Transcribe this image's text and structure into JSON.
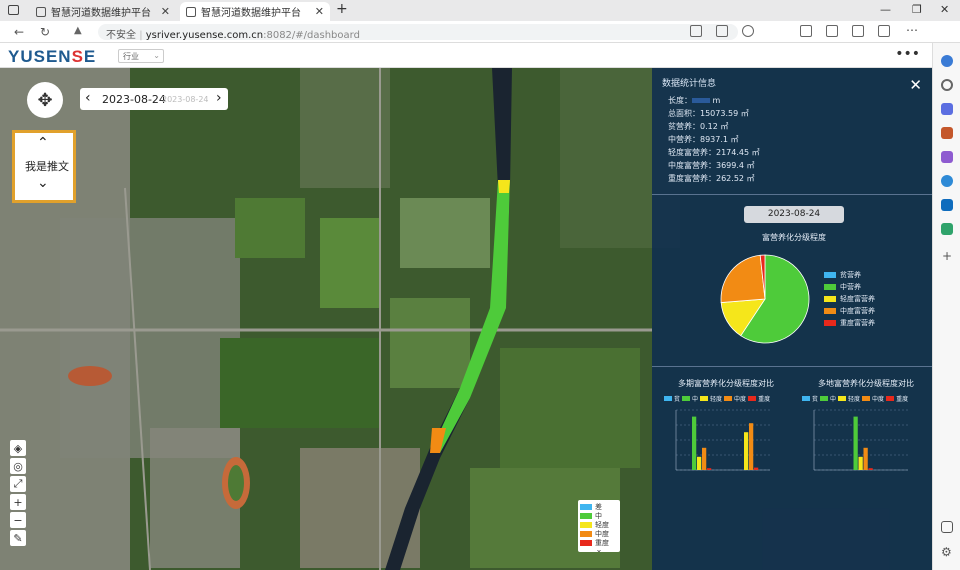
{
  "browser": {
    "tabs": [
      {
        "title": "智慧河道数据维护平台",
        "active": false
      },
      {
        "title": "智慧河道数据维护平台",
        "active": true
      }
    ],
    "new_tab": "+",
    "security": "不安全",
    "url_host": "ysriver.yusense.com.cn",
    "url_rest": ":8082/#/dashboard"
  },
  "app": {
    "logo_a": "YUSEN",
    "logo_b": "S",
    "logo_c": "E",
    "industry_select": "行业",
    "more_label": "•••"
  },
  "map": {
    "date_current": "2023-08-24",
    "date_compare": "2023-08-24",
    "scroll_label": "我是推文",
    "legend": [
      {
        "label": "差",
        "color": "#3fb5f0"
      },
      {
        "label": "中",
        "color": "#4ecb3a"
      },
      {
        "label": "轻度",
        "color": "#f5e61b"
      },
      {
        "label": "中度",
        "color": "#f28b14"
      },
      {
        "label": "重度",
        "color": "#e8291c"
      }
    ]
  },
  "panel": {
    "title": "数据统计信息",
    "stats": [
      {
        "label": "长度",
        "value": "m",
        "redacted": true
      },
      {
        "label": "总面积",
        "value": "15073.59 ㎡"
      },
      {
        "label": "贫营养",
        "value": "0.12 ㎡"
      },
      {
        "label": "中营养",
        "value": "8937.1 ㎡"
      },
      {
        "label": "轻度富营养",
        "value": "2174.45 ㎡"
      },
      {
        "label": "中度富营养",
        "value": "3699.4 ㎡"
      },
      {
        "label": "重度富营养",
        "value": "262.52 ㎡"
      }
    ],
    "pie_date": "2023-08-24",
    "pie_title": "富营养化分级程度",
    "bar1_title": "多期富营养化分级程度对比",
    "bar2_title": "多地富营养化分级程度对比",
    "bar_legend": [
      "贫",
      "中",
      "轻度",
      "中度",
      "重度"
    ]
  },
  "chart_data": [
    {
      "type": "pie",
      "title": "富营养化分级程度",
      "categories": [
        "贫营养",
        "中营养",
        "轻度富营养",
        "中度富营养",
        "重度富营养"
      ],
      "values": [
        0.12,
        8937.1,
        2174.45,
        3699.4,
        262.52
      ],
      "colors": [
        "#3fb5f0",
        "#4ecb3a",
        "#f5e61b",
        "#f28b14",
        "#e8291c"
      ],
      "legend": "right"
    },
    {
      "type": "bar",
      "title": "多期富营养化分级程度对比",
      "categories": [
        "",
        ""
      ],
      "series": [
        {
          "name": "贫",
          "values": [
            0,
            0
          ]
        },
        {
          "name": "中",
          "values": [
            8900,
            0
          ]
        },
        {
          "name": "轻度",
          "values": [
            2200,
            6300
          ]
        },
        {
          "name": "中度",
          "values": [
            3700,
            7800
          ]
        },
        {
          "name": "重度",
          "values": [
            300,
            400
          ]
        }
      ],
      "colors": [
        "#3fb5f0",
        "#4ecb3a",
        "#f5e61b",
        "#f28b14",
        "#e8291c"
      ],
      "ylim": [
        0,
        10000
      ]
    },
    {
      "type": "bar",
      "title": "多地富营养化分级程度对比",
      "categories": [
        ""
      ],
      "series": [
        {
          "name": "贫",
          "values": [
            0
          ]
        },
        {
          "name": "中",
          "values": [
            8900
          ]
        },
        {
          "name": "轻度",
          "values": [
            2200
          ]
        },
        {
          "name": "中度",
          "values": [
            3700
          ]
        },
        {
          "name": "重度",
          "values": [
            300
          ]
        }
      ],
      "colors": [
        "#3fb5f0",
        "#4ecb3a",
        "#f5e61b",
        "#f28b14",
        "#e8291c"
      ],
      "ylim": [
        0,
        10000
      ]
    }
  ]
}
